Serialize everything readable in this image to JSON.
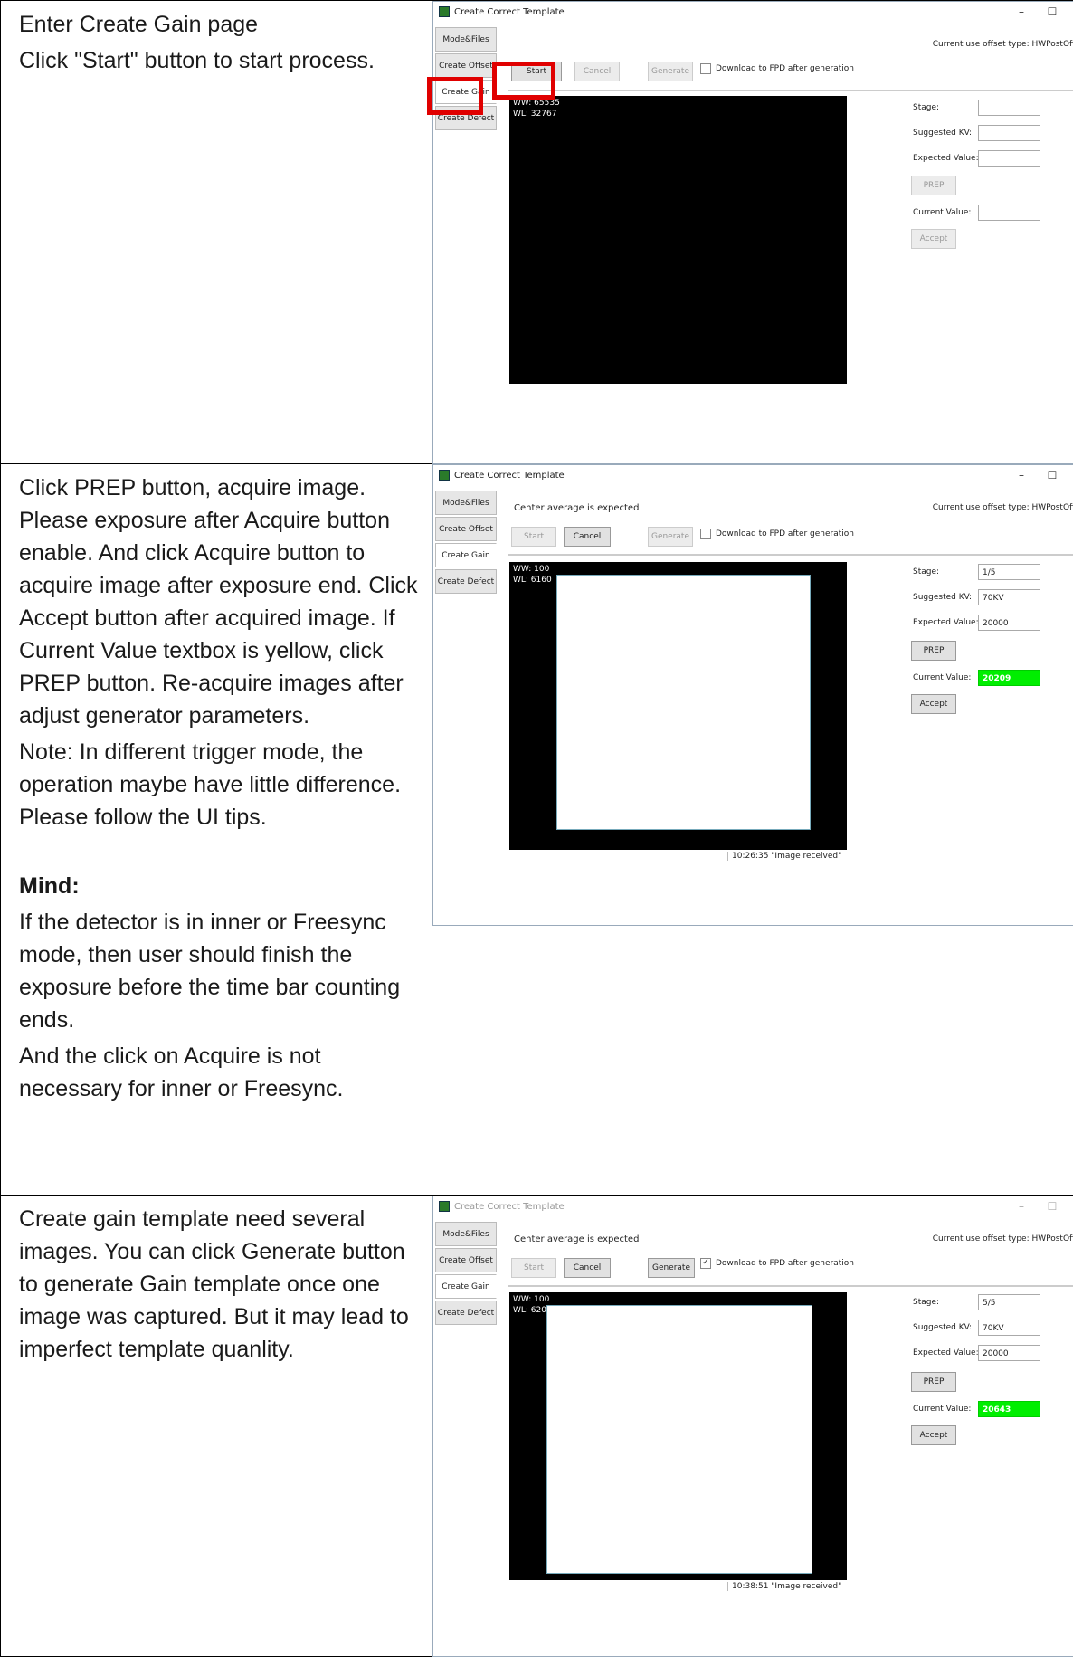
{
  "steps": [
    {
      "paragraphs": [
        "Enter Create Gain page",
        "Click \"Start\" button to start process."
      ],
      "window": {
        "title": "Create Correct Template",
        "tabs": [
          "Mode&Files",
          "Create Offset",
          "Create Gain",
          "Create Defect"
        ],
        "expect_text": "",
        "offset_type": "Current use offset type: HWPostOffset",
        "start": "Start",
        "cancel": "Cancel",
        "generate": "Generate",
        "download_label": "Download to FPD after generation",
        "ww": "WW:  65535",
        "wl": "WL:  32767",
        "stage_label": "Stage:",
        "stage": "",
        "kv_label": "Suggested KV:",
        "kv": "",
        "expected_label": "Expected Value:",
        "expected": "",
        "prep": "PREP",
        "current_label": "Current Value:",
        "current": "",
        "accept": "Accept",
        "status": ""
      }
    },
    {
      "paragraphs": [
        "Click PREP button, acquire image. Please exposure after Acquire button enable. And click Acquire button to acquire image after exposure end. Click Accept button after acquired image. If Current Value textbox is yellow, click PREP button. Re-acquire images after adjust generator parameters.",
        "Note: In different trigger mode, the operation maybe have little difference. Please follow the UI tips."
      ],
      "mind_heading": "Mind:",
      "mind_paragraphs": [
        "If the detector is in inner or Freesync mode, then user should finish the exposure before the time bar counting ends.",
        "And the click on Acquire is not necessary for inner or Freesync."
      ],
      "window": {
        "title": "Create Correct Template",
        "tabs": [
          "Mode&Files",
          "Create Offset",
          "Create Gain",
          "Create Defect"
        ],
        "expect_text": "Center average is expected",
        "offset_type": "Current use offset type: HWPostOffset",
        "start": "Start",
        "cancel": "Cancel",
        "generate": "Generate",
        "download_label": "Download to FPD after generation",
        "ww": "WW:  100",
        "wl": "WL:  6160",
        "stage_label": "Stage:",
        "stage": "1/5",
        "kv_label": "Suggested KV:",
        "kv": "70KV",
        "expected_label": "Expected Value:",
        "expected": "20000",
        "prep": "PREP",
        "current_label": "Current Value:",
        "current": "20209",
        "accept": "Accept",
        "status": "10:26:35 \"Image received\""
      }
    },
    {
      "paragraphs": [
        "Create gain template need several images. You can click Generate button to generate Gain template once one image was captured. But it may lead to imperfect template quanlity."
      ],
      "window": {
        "title": "Create Correct Template",
        "tabs": [
          "Mode&Files",
          "Create Offset",
          "Create Gain",
          "Create Defect"
        ],
        "expect_text": "Center average is expected",
        "offset_type": "Current use offset type: HWPostOffset",
        "start": "Start",
        "cancel": "Cancel",
        "generate": "Generate",
        "download_label": "Download to FPD after generation",
        "ww": "WW:  100",
        "wl": "WL:  620",
        "stage_label": "Stage:",
        "stage": "5/5",
        "kv_label": "Suggested KV:",
        "kv": "70KV",
        "expected_label": "Expected Value:",
        "expected": "20000",
        "prep": "PREP",
        "current_label": "Current Value:",
        "current": "20643",
        "accept": "Accept",
        "status": "10:38:51 \"Image received\""
      }
    }
  ],
  "icons": {
    "minimize": "–",
    "maximize": "☐",
    "close": "✕",
    "check": "✓",
    "scroll_down": "⌄"
  },
  "colors": {
    "highlight": "#e00000",
    "current_value_ok": "#00ee00"
  }
}
